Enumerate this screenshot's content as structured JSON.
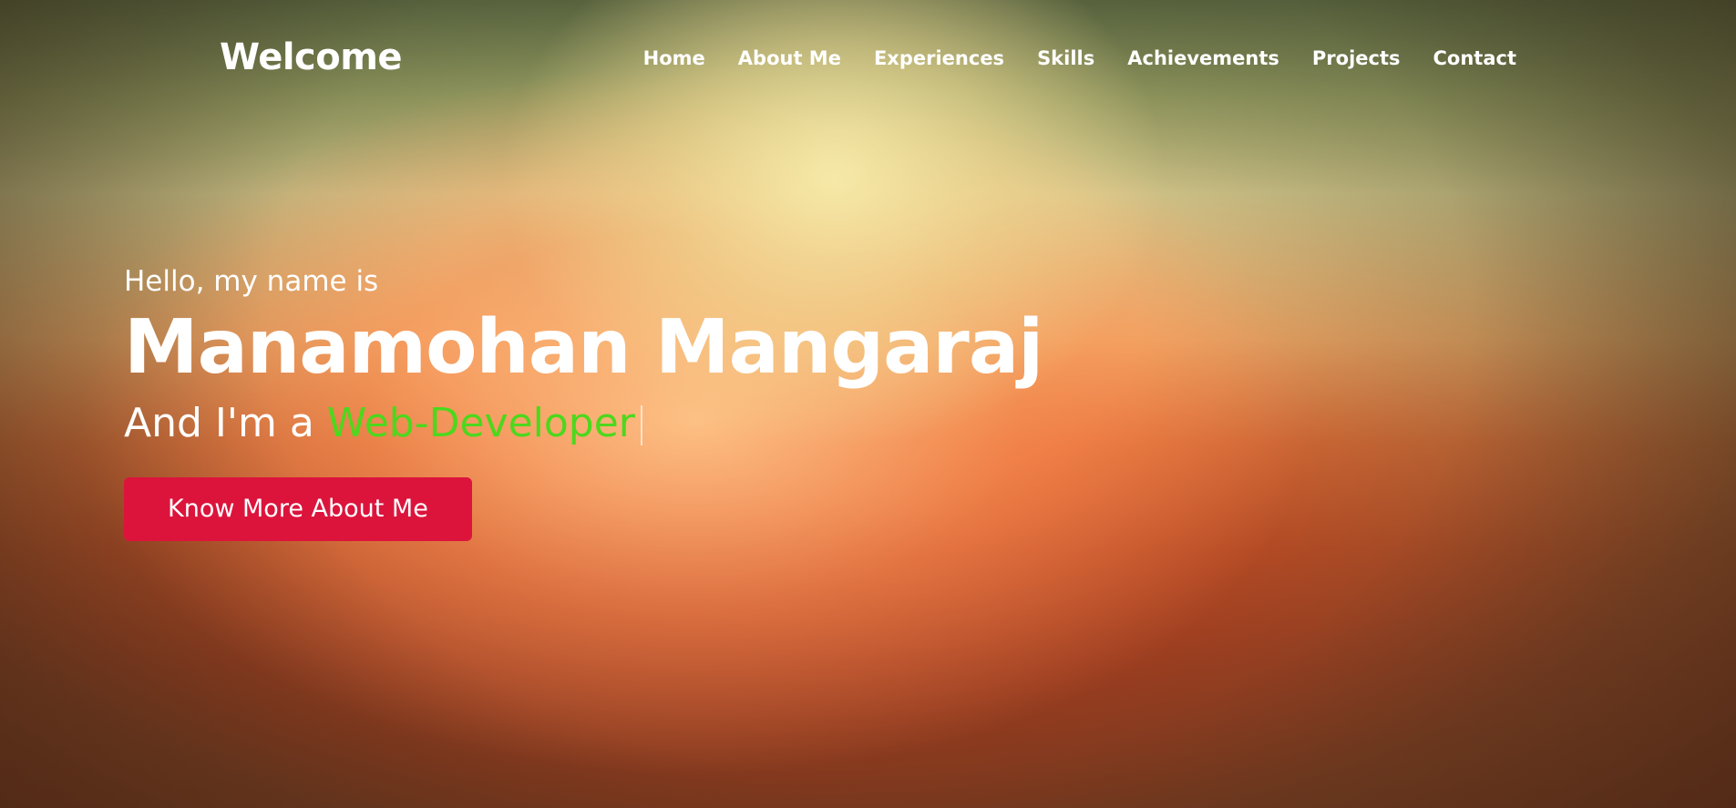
{
  "nav": {
    "brand": "Welcome",
    "items": [
      {
        "label": "Home"
      },
      {
        "label": "About Me"
      },
      {
        "label": "Experiences"
      },
      {
        "label": "Skills"
      },
      {
        "label": "Achievements"
      },
      {
        "label": "Projects"
      },
      {
        "label": "Contact"
      }
    ]
  },
  "hero": {
    "greeting": "Hello, my name is",
    "name": "Manamohan Mangaraj",
    "role_prefix": "And I'm a",
    "role_typed": "Web-Developer",
    "cta_label": "Know More About Me"
  },
  "colors": {
    "accent_button": "#dc143c",
    "typed_text": "#4cd81c",
    "text": "#ffffff"
  }
}
